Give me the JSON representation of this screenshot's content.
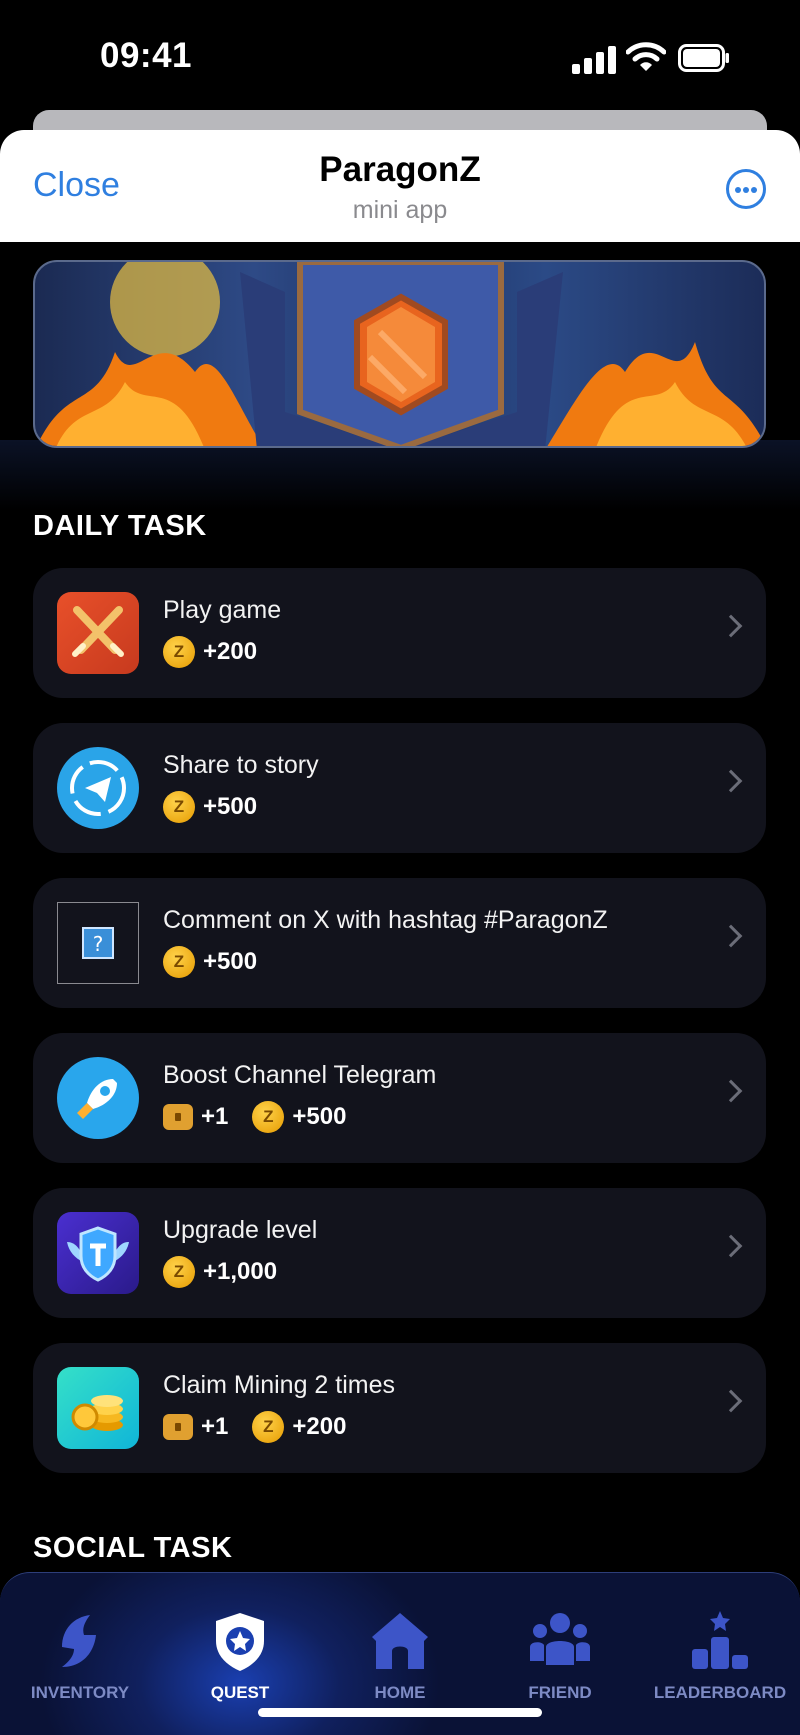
{
  "status_bar": {
    "time": "09:41"
  },
  "header": {
    "close_label": "Close",
    "title": "ParagonZ",
    "subtitle": "mini app"
  },
  "sections": {
    "daily": "DAILY TASK",
    "social": "SOCIAL TASK"
  },
  "tasks": [
    {
      "name": "Play game",
      "coin": "+200"
    },
    {
      "name": "Share to story",
      "coin": "+500"
    },
    {
      "name": "Comment on X with hashtag #ParagonZ",
      "coin": "+500"
    },
    {
      "name": "Boost Channel Telegram",
      "chest": "+1",
      "coin": "+500"
    },
    {
      "name": "Upgrade level",
      "coin": "+1,000"
    },
    {
      "name": "Claim Mining 2 times",
      "chest": "+1",
      "coin": "+200"
    }
  ],
  "nav": {
    "inventory": "INVENTORY",
    "quest": "QUEST",
    "home": "HOME",
    "friend": "FRIEND",
    "leaderboard": "LEADERBOARD",
    "active": "quest"
  },
  "colors": {
    "accent": "#2f7fe0",
    "card": "#12131c",
    "nav_active": "#ffffff",
    "nav_inactive": "#7d8ac4"
  }
}
